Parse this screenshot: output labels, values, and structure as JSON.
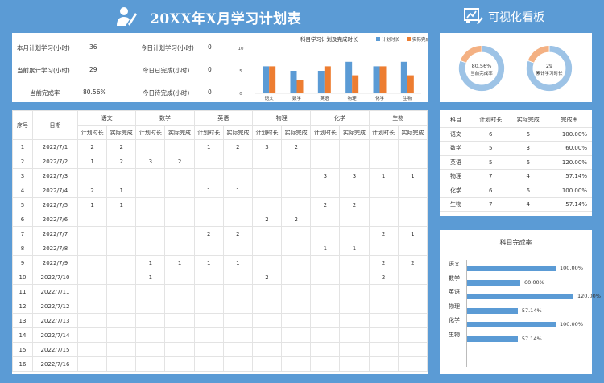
{
  "header": {
    "title": "20XX年X月学习计划表",
    "board_title": "可视化看板"
  },
  "summary": {
    "month_plan_label": "本月计划学习(小时)",
    "month_plan_value": "36",
    "today_plan_label": "今日计划学习(小时)",
    "today_plan_value": "0",
    "cum_study_label": "当前累计学习(小时)",
    "cum_study_value": "29",
    "today_done_label": "今日已完成(小时)",
    "today_done_value": "0",
    "cur_rate_label": "当前完成率",
    "cur_rate_value": "80.56%",
    "today_todo_label": "今日待完成(小时)",
    "today_todo_value": "0"
  },
  "chart_data": {
    "type": "bar",
    "title": "科目学习计划及完成时长",
    "categories": [
      "语文",
      "数学",
      "英语",
      "物理",
      "化学",
      "生物"
    ],
    "series": [
      {
        "name": "计划时长",
        "values": [
          6,
          5,
          5,
          7,
          6,
          7
        ],
        "color": "#5b9bd5"
      },
      {
        "name": "实际完成",
        "values": [
          6,
          3,
          6,
          4,
          6,
          4
        ],
        "color": "#ed7d31"
      }
    ],
    "ylim": [
      0,
      10
    ],
    "yticks": [
      "10",
      "5",
      "0"
    ]
  },
  "donuts": [
    {
      "label": "当前完成率",
      "value_text": "80.56%",
      "fraction": 0.8056
    },
    {
      "label": "累计学习时长",
      "value_text": "29",
      "fraction": 0.8056
    }
  ],
  "donut_colors": {
    "filled": "#9dc3e6",
    "remaining": "#f4b183"
  },
  "daily": {
    "col_index": "序号",
    "col_date": "日期",
    "subjects": [
      "语文",
      "数学",
      "英语",
      "物理",
      "化学",
      "生物"
    ],
    "sub_plan": "计划时长",
    "sub_actual": "实际完成",
    "rows": [
      {
        "no": "1",
        "date": "2022/7/1",
        "cells": [
          "2",
          "2",
          "",
          "",
          "1",
          "2",
          "3",
          "2",
          "",
          "",
          "",
          ""
        ]
      },
      {
        "no": "2",
        "date": "2022/7/2",
        "cells": [
          "1",
          "2",
          "3",
          "2",
          "",
          "",
          "",
          "",
          "",
          "",
          "",
          ""
        ]
      },
      {
        "no": "3",
        "date": "2022/7/3",
        "cells": [
          "",
          "",
          "",
          "",
          "",
          "",
          "",
          "",
          "3",
          "3",
          "1",
          "1"
        ]
      },
      {
        "no": "4",
        "date": "2022/7/4",
        "cells": [
          "2",
          "1",
          "",
          "",
          "1",
          "1",
          "",
          "",
          "",
          "",
          "",
          ""
        ]
      },
      {
        "no": "5",
        "date": "2022/7/5",
        "cells": [
          "1",
          "1",
          "",
          "",
          "",
          "",
          "",
          "",
          "2",
          "2",
          "",
          ""
        ]
      },
      {
        "no": "6",
        "date": "2022/7/6",
        "cells": [
          "",
          "",
          "",
          "",
          "",
          "",
          "2",
          "2",
          "",
          "",
          "",
          ""
        ]
      },
      {
        "no": "7",
        "date": "2022/7/7",
        "cells": [
          "",
          "",
          "",
          "",
          "2",
          "2",
          "",
          "",
          "",
          "",
          "2",
          "1"
        ]
      },
      {
        "no": "8",
        "date": "2022/7/8",
        "cells": [
          "",
          "",
          "",
          "",
          "",
          "",
          "",
          "",
          "1",
          "1",
          "",
          ""
        ]
      },
      {
        "no": "9",
        "date": "2022/7/9",
        "cells": [
          "",
          "",
          "1",
          "1",
          "1",
          "1",
          "",
          "",
          "",
          "",
          "2",
          "2"
        ]
      },
      {
        "no": "10",
        "date": "2022/7/10",
        "cells": [
          "",
          "",
          "1",
          "",
          "",
          "",
          "2",
          "",
          "",
          "",
          "2",
          ""
        ]
      },
      {
        "no": "11",
        "date": "2022/7/11",
        "cells": [
          "",
          "",
          "",
          "",
          "",
          "",
          "",
          "",
          "",
          "",
          "",
          ""
        ]
      },
      {
        "no": "12",
        "date": "2022/7/12",
        "cells": [
          "",
          "",
          "",
          "",
          "",
          "",
          "",
          "",
          "",
          "",
          "",
          ""
        ]
      },
      {
        "no": "13",
        "date": "2022/7/13",
        "cells": [
          "",
          "",
          "",
          "",
          "",
          "",
          "",
          "",
          "",
          "",
          "",
          ""
        ]
      },
      {
        "no": "14",
        "date": "2022/7/14",
        "cells": [
          "",
          "",
          "",
          "",
          "",
          "",
          "",
          "",
          "",
          "",
          "",
          ""
        ]
      },
      {
        "no": "15",
        "date": "2022/7/15",
        "cells": [
          "",
          "",
          "",
          "",
          "",
          "",
          "",
          "",
          "",
          "",
          "",
          ""
        ]
      },
      {
        "no": "16",
        "date": "2022/7/16",
        "cells": [
          "",
          "",
          "",
          "",
          "",
          "",
          "",
          "",
          "",
          "",
          "",
          ""
        ]
      }
    ]
  },
  "subject_table": {
    "headers": [
      "科目",
      "计划时长",
      "实际完成",
      "完成率"
    ],
    "rows": [
      [
        "语文",
        "6",
        "6",
        "100.00%"
      ],
      [
        "数学",
        "5",
        "3",
        "60.00%"
      ],
      [
        "英语",
        "5",
        "6",
        "120.00%"
      ],
      [
        "物理",
        "7",
        "4",
        "57.14%"
      ],
      [
        "化学",
        "6",
        "6",
        "100.00%"
      ],
      [
        "生物",
        "7",
        "4",
        "57.14%"
      ]
    ]
  },
  "rates": {
    "title": "科目完成率",
    "items": [
      {
        "label": "语文",
        "value": 1.0,
        "text": "100.00%"
      },
      {
        "label": "数学",
        "value": 0.6,
        "text": "60.00%"
      },
      {
        "label": "英语",
        "value": 1.2,
        "text": "120.00%"
      },
      {
        "label": "物理",
        "value": 0.5714,
        "text": "57.14%"
      },
      {
        "label": "化学",
        "value": 1.0,
        "text": "100.00%"
      },
      {
        "label": "生物",
        "value": 0.5714,
        "text": "57.14%"
      }
    ]
  }
}
